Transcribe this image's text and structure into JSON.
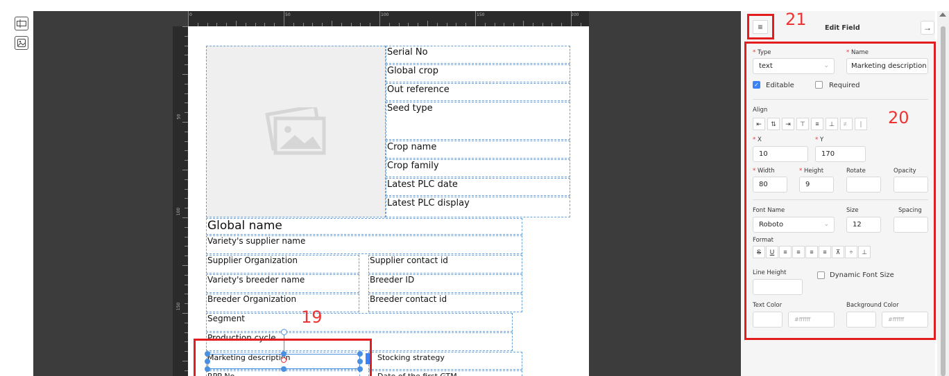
{
  "toolbar": {
    "text_tool_icon": "text-field-icon",
    "image_tool_icon": "image-icon"
  },
  "ruler": {
    "top_labels": [
      "0",
      "50",
      "100",
      "150",
      "200"
    ],
    "left_labels": [
      "50",
      "100",
      "150"
    ]
  },
  "canvas": {
    "fields": {
      "serial_no": "Serial No",
      "global_crop": "Global crop",
      "out_reference": "Out reference",
      "seed_type": "Seed type",
      "crop_name": "Crop name",
      "crop_family": "Crop family",
      "latest_plc_date": "Latest PLC date",
      "latest_plc_display": "Latest PLC display",
      "global_name": "Global name",
      "variety_supplier_name": "Variety's supplier name",
      "supplier_organization": "Supplier Organization",
      "supplier_contact_id": "Supplier contact id",
      "variety_breeder_name": "Variety's breeder name",
      "breeder_id": "Breeder ID",
      "breeder_organization": "Breeder Organization",
      "breeder_contact_id": "Breeder contact id",
      "segment": "Segment",
      "production_cycle": "Production cycle",
      "marketing_description": "Marketing description",
      "stocking_strategy": "Stocking strategy",
      "rpp_no": "RPP No",
      "first_gtm": "Date of the first GTM"
    }
  },
  "annotations": {
    "canvas_marker": "19",
    "panel_fields_marker": "20",
    "menu_marker": "21"
  },
  "panel": {
    "title": "Edit Field",
    "type_label": "Type",
    "type_value": "text",
    "name_label": "Name",
    "name_value": "Marketing description",
    "editable_label": "Editable",
    "editable_checked": true,
    "required_label": "Required",
    "required_checked": false,
    "align_label": "Align",
    "x_label": "X",
    "x_value": "10",
    "y_label": "Y",
    "y_value": "170",
    "width_label": "Width",
    "width_value": "80",
    "height_label": "Height",
    "height_value": "9",
    "rotate_label": "Rotate",
    "rotate_value": "",
    "opacity_label": "Opacity",
    "opacity_value": "",
    "font_name_label": "Font Name",
    "font_name_value": "Roboto",
    "size_label": "Size",
    "size_value": "12",
    "spacing_label": "Spacing",
    "spacing_value": "",
    "format_label": "Format",
    "line_height_label": "Line Height",
    "line_height_value": "",
    "dynamic_font_label": "Dynamic Font Size",
    "dynamic_font_checked": false,
    "text_color_label": "Text Color",
    "text_color_value": "#ffffff",
    "bg_color_label": "Background Color",
    "bg_color_value": "#ffffff"
  },
  "colors": {
    "accent": "#3b82f6",
    "annotation_red": "#e31d1d",
    "field_border": "#6aa0d8"
  }
}
